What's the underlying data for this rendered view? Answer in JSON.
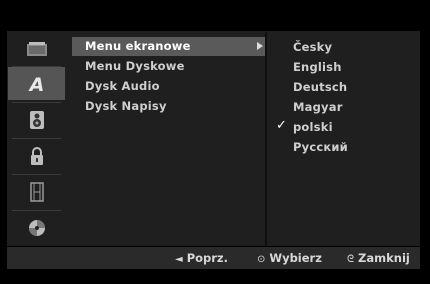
{
  "sidebar": {
    "items": [
      {
        "icon": "folder-icon",
        "glyph": "▬"
      },
      {
        "icon": "language-icon",
        "glyph": "A"
      },
      {
        "icon": "speaker-icon",
        "glyph": "◙"
      },
      {
        "icon": "lock-icon",
        "glyph": "🔒"
      },
      {
        "icon": "film-icon",
        "glyph": "▥"
      },
      {
        "icon": "disc-icon",
        "glyph": "◉"
      }
    ],
    "active_index": 1
  },
  "menu": {
    "items": [
      {
        "label": "Menu ekranowe"
      },
      {
        "label": "Menu Dyskowe"
      },
      {
        "label": "Dysk Audio"
      },
      {
        "label": "Dysk Napisy"
      }
    ],
    "selected_index": 0
  },
  "options": {
    "items": [
      {
        "label": "Česky"
      },
      {
        "label": "English"
      },
      {
        "label": "Deutsch"
      },
      {
        "label": "Magyar"
      },
      {
        "label": "polski"
      },
      {
        "label": "Русский"
      }
    ],
    "checked_index": 4,
    "check_glyph": "✓"
  },
  "footer": {
    "prev_icon": "◄",
    "prev_label": "Poprz.",
    "select_icon": "⊙",
    "select_label": "Wybierz",
    "close_icon": "ᘓ",
    "close_label": "Zamknij"
  },
  "colors": {
    "background": "#000000",
    "panel": "#1f1f1f",
    "highlight": "#5a5a5a",
    "text": "#cfcfcf"
  }
}
